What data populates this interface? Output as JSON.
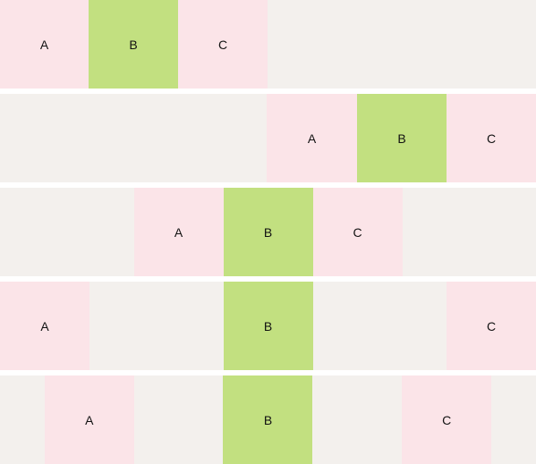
{
  "rows": [
    {
      "items": [
        {
          "label": "A",
          "color": "#fbe4e8"
        },
        {
          "label": "B",
          "color": "#c2e080"
        },
        {
          "label": "C",
          "color": "#fbe4e8"
        }
      ]
    },
    {
      "items": [
        {
          "label": "A",
          "color": "#fbe4e8"
        },
        {
          "label": "B",
          "color": "#c2e080"
        },
        {
          "label": "C",
          "color": "#fbe4e8"
        }
      ]
    },
    {
      "items": [
        {
          "label": "A",
          "color": "#fbe4e8"
        },
        {
          "label": "B",
          "color": "#c2e080"
        },
        {
          "label": "C",
          "color": "#fbe4e8"
        }
      ]
    },
    {
      "items": [
        {
          "label": "A",
          "color": "#fbe4e8"
        },
        {
          "label": "B",
          "color": "#c2e080"
        },
        {
          "label": "C",
          "color": "#fbe4e8"
        }
      ]
    },
    {
      "items": [
        {
          "label": "A",
          "color": "#fbe4e8"
        },
        {
          "label": "B",
          "color": "#c2e080"
        },
        {
          "label": "C",
          "color": "#fbe4e8"
        }
      ]
    }
  ],
  "colors": {
    "container_bg": "#f3f0ed",
    "pink": "#fbe4e8",
    "green": "#c2e080"
  }
}
